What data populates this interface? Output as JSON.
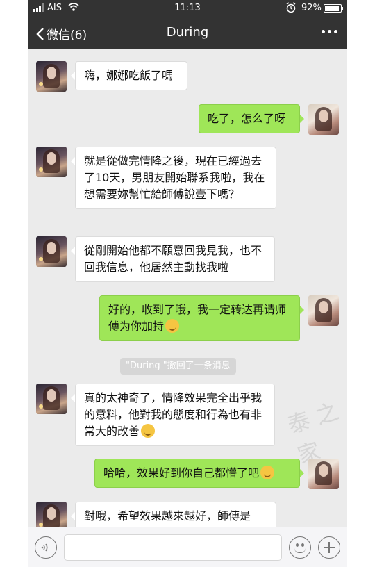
{
  "status_bar": {
    "carrier": "AIS",
    "time": "11:13",
    "battery": "92%"
  },
  "nav": {
    "back_label": "微信(6)",
    "title": "During"
  },
  "messages": [
    {
      "side": "in",
      "text": "嗨，娜娜吃飯了嗎"
    },
    {
      "side": "out",
      "text": "吃了，怎么了呀"
    },
    {
      "side": "in",
      "text": "就是從做完情降之後，現在已經過去了10天，男朋友開始聯系我啦，我在想需要妳幫忙給師傅說壹下嗎？"
    },
    {
      "side": "in",
      "text": "從剛開始他都不願意回我見我，也不回我信息，他居然主動找我啦"
    },
    {
      "side": "out",
      "text": "好的，收到了哦，我一定转达再请师傅为你加持"
    },
    {
      "side": "in",
      "text": "真的太神奇了，情降效果完全出乎我的意料，他對我的態度和行為也有非常大的改善"
    },
    {
      "side": "out",
      "text": "哈哈，效果好到你自己都懵了吧"
    },
    {
      "side": "in",
      "text": "對哦，希望效果越來越好，師傅是"
    }
  ],
  "system_notice": "\"During \"撤回了一条消息",
  "watermark": "泰 之 家",
  "colors": {
    "header": "#333333",
    "chat_bg": "#ebebeb",
    "out_bubble": "#9fe658",
    "in_bubble": "#ffffff"
  },
  "icons": [
    "signal-icon",
    "wifi-icon",
    "alarm-icon",
    "battery-icon",
    "back-chevron-icon",
    "more-icon",
    "voice-icon",
    "emoji-icon",
    "plus-icon"
  ]
}
